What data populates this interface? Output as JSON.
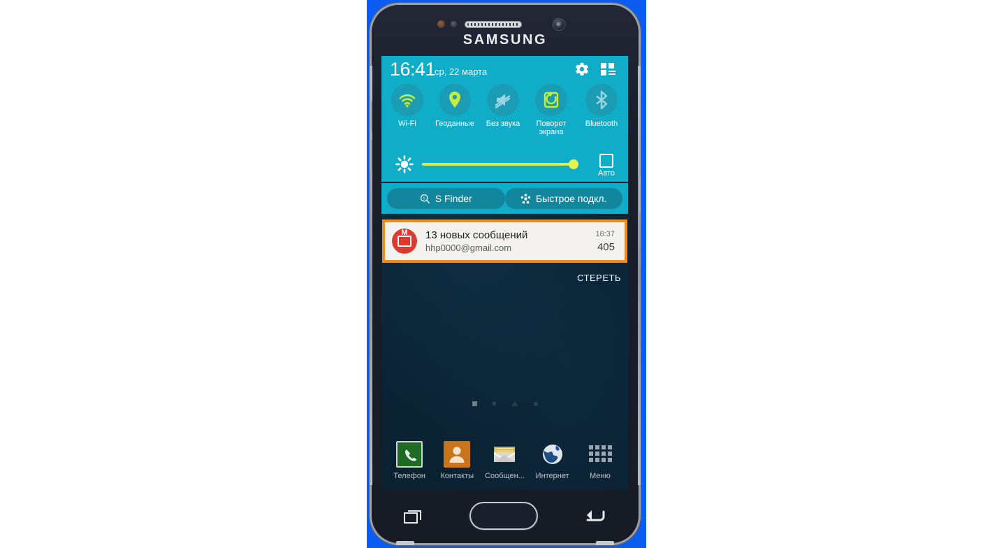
{
  "device": {
    "brand": "SAMSUNG"
  },
  "quick_settings": {
    "time": "16:41",
    "date": "ср, 22 марта",
    "gear_icon": "gear-icon",
    "edit_icon": "edit-grid-icon",
    "panel_color": "#0fadc8",
    "toggles": [
      {
        "label": "Wi-Fi",
        "icon": "wifi-icon",
        "state": "on",
        "accent": "#c6ec3c"
      },
      {
        "label": "Геоданные",
        "icon": "location-pin-icon",
        "state": "on",
        "accent": "#c6ec3c"
      },
      {
        "label": "Без звука",
        "icon": "mute-icon",
        "state": "off",
        "accent": "#8fd4e0"
      },
      {
        "label": "Поворот экрана",
        "icon": "screen-rotation-icon",
        "state": "on",
        "accent": "#c6ec3c"
      },
      {
        "label": "Bluetooth",
        "icon": "bluetooth-icon",
        "state": "off",
        "accent": "#8fd4e0"
      }
    ],
    "brightness": {
      "icon": "brightness-sun-icon",
      "value_percent": 95,
      "auto_label": "Авто",
      "auto_checked": false,
      "track_color": "#d8f14a"
    },
    "s_finder": {
      "label": "S Finder",
      "icon": "search-circle-icon"
    },
    "quick_connect": {
      "label": "Быстрое подкл.",
      "icon": "quick-connect-icon"
    }
  },
  "notification": {
    "highlight_color": "#f08a1a",
    "app_icon": "gmail-icon",
    "title": "13 новых сообщений",
    "subtitle": "hhp0000@gmail.com",
    "time": "16:37",
    "count": "405",
    "clear_label": "СТЕРЕТЬ"
  },
  "home": {
    "page_indicators": [
      "active",
      "small",
      "home",
      "round"
    ],
    "dock": [
      {
        "label": "Телефон",
        "icon": "phone-icon"
      },
      {
        "label": "Контакты",
        "icon": "contacts-icon"
      },
      {
        "label": "Сообщен...",
        "icon": "messages-icon"
      },
      {
        "label": "Интернет",
        "icon": "internet-globe-icon"
      },
      {
        "label": "Меню",
        "icon": "apps-grid-icon"
      }
    ]
  },
  "navbar": {
    "recent": "recent-apps-icon",
    "home": "home-button",
    "back": "back-icon"
  }
}
